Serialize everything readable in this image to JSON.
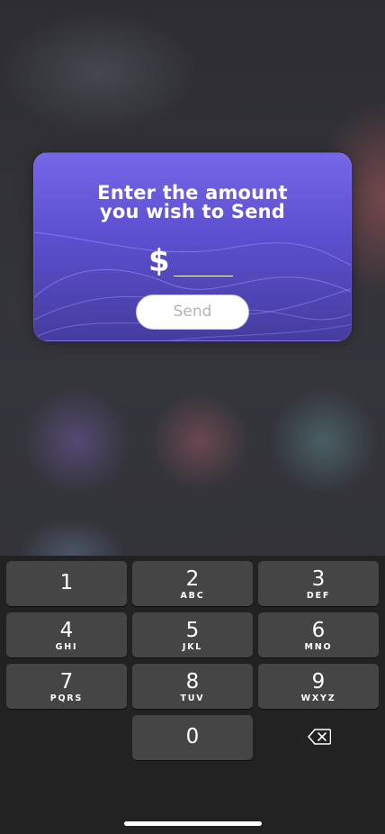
{
  "modal": {
    "title_line1": "Enter the amount",
    "title_line2": "you wish to Send",
    "currency_symbol": "$",
    "amount_value": "",
    "send_label": "Send"
  },
  "keypad": {
    "keys": [
      {
        "digit": "1",
        "letters": ""
      },
      {
        "digit": "2",
        "letters": "ABC"
      },
      {
        "digit": "3",
        "letters": "DEF"
      },
      {
        "digit": "4",
        "letters": "GHI"
      },
      {
        "digit": "5",
        "letters": "JKL"
      },
      {
        "digit": "6",
        "letters": "MNO"
      },
      {
        "digit": "7",
        "letters": "PQRS"
      },
      {
        "digit": "8",
        "letters": "TUV"
      },
      {
        "digit": "9",
        "letters": "WXYZ"
      },
      {
        "digit": "0",
        "letters": ""
      }
    ],
    "delete_icon": "backspace-icon"
  },
  "colors": {
    "card_top": "#7567e8",
    "card_bottom": "#463c9e",
    "keyboard_bg": "#222222",
    "key_bg": "#454545"
  }
}
